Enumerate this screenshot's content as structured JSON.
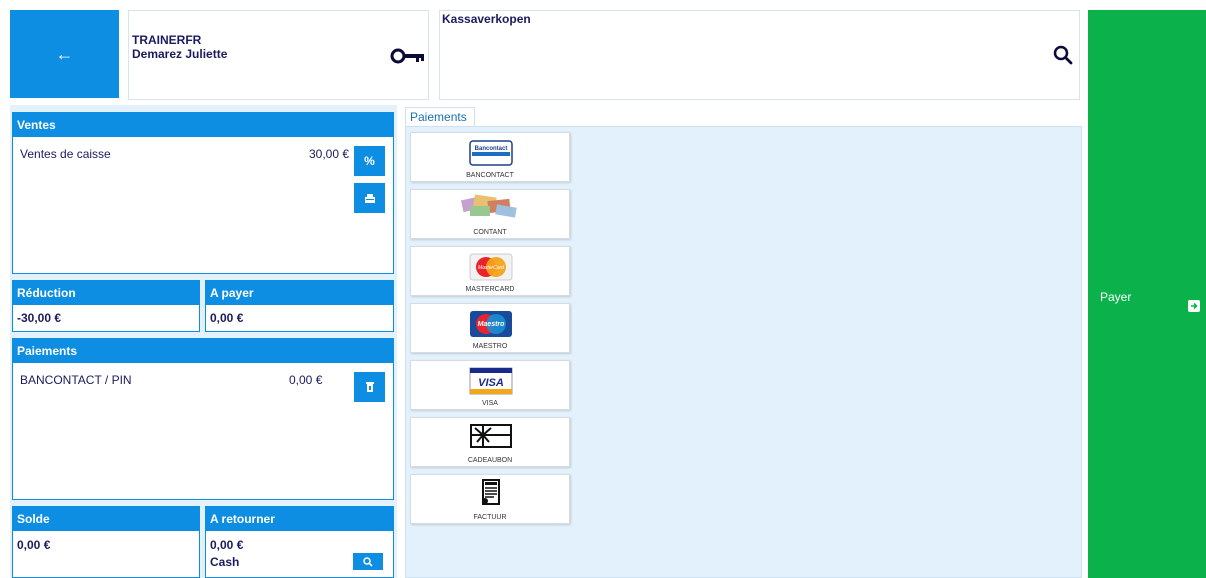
{
  "top": {
    "back_label": "←",
    "user_code": "TRAINERFR",
    "user_name": "Demarez Juliette",
    "search_title": "Kassaverkopen"
  },
  "ventes": {
    "header": "Ventes",
    "item_label": "Ventes de caisse",
    "item_amount": "30,00 €"
  },
  "reduction": {
    "header": "Réduction",
    "value": "-30,00 €"
  },
  "a_payer": {
    "header": "A payer",
    "value": "0,00 €"
  },
  "paiements": {
    "header": "Paiements",
    "line_label": "BANCONTACT / PIN",
    "line_amount": "0,00 €"
  },
  "solde": {
    "header": "Solde",
    "value": "0,00 €"
  },
  "a_retourner": {
    "header": "A retourner",
    "value": "0,00 €",
    "method": "Cash"
  },
  "payment_tab": "Paiements",
  "payment_methods": [
    {
      "label": "BANCONTACT",
      "logo_text": "Bancontact"
    },
    {
      "label": "CONTANT"
    },
    {
      "label": "MASTERCARD",
      "logo_text": "MasterCard"
    },
    {
      "label": "MAESTRO",
      "logo_text": "Maestro"
    },
    {
      "label": "VISA",
      "logo_text": "VISA"
    },
    {
      "label": "CADEAUBON"
    },
    {
      "label": "FACTUUR"
    }
  ],
  "pay_button": "Payer",
  "colors": {
    "accent": "#0e8ee3",
    "pay": "#0bb24b",
    "text": "#1b1b5e",
    "area": "#e2f1fb"
  }
}
